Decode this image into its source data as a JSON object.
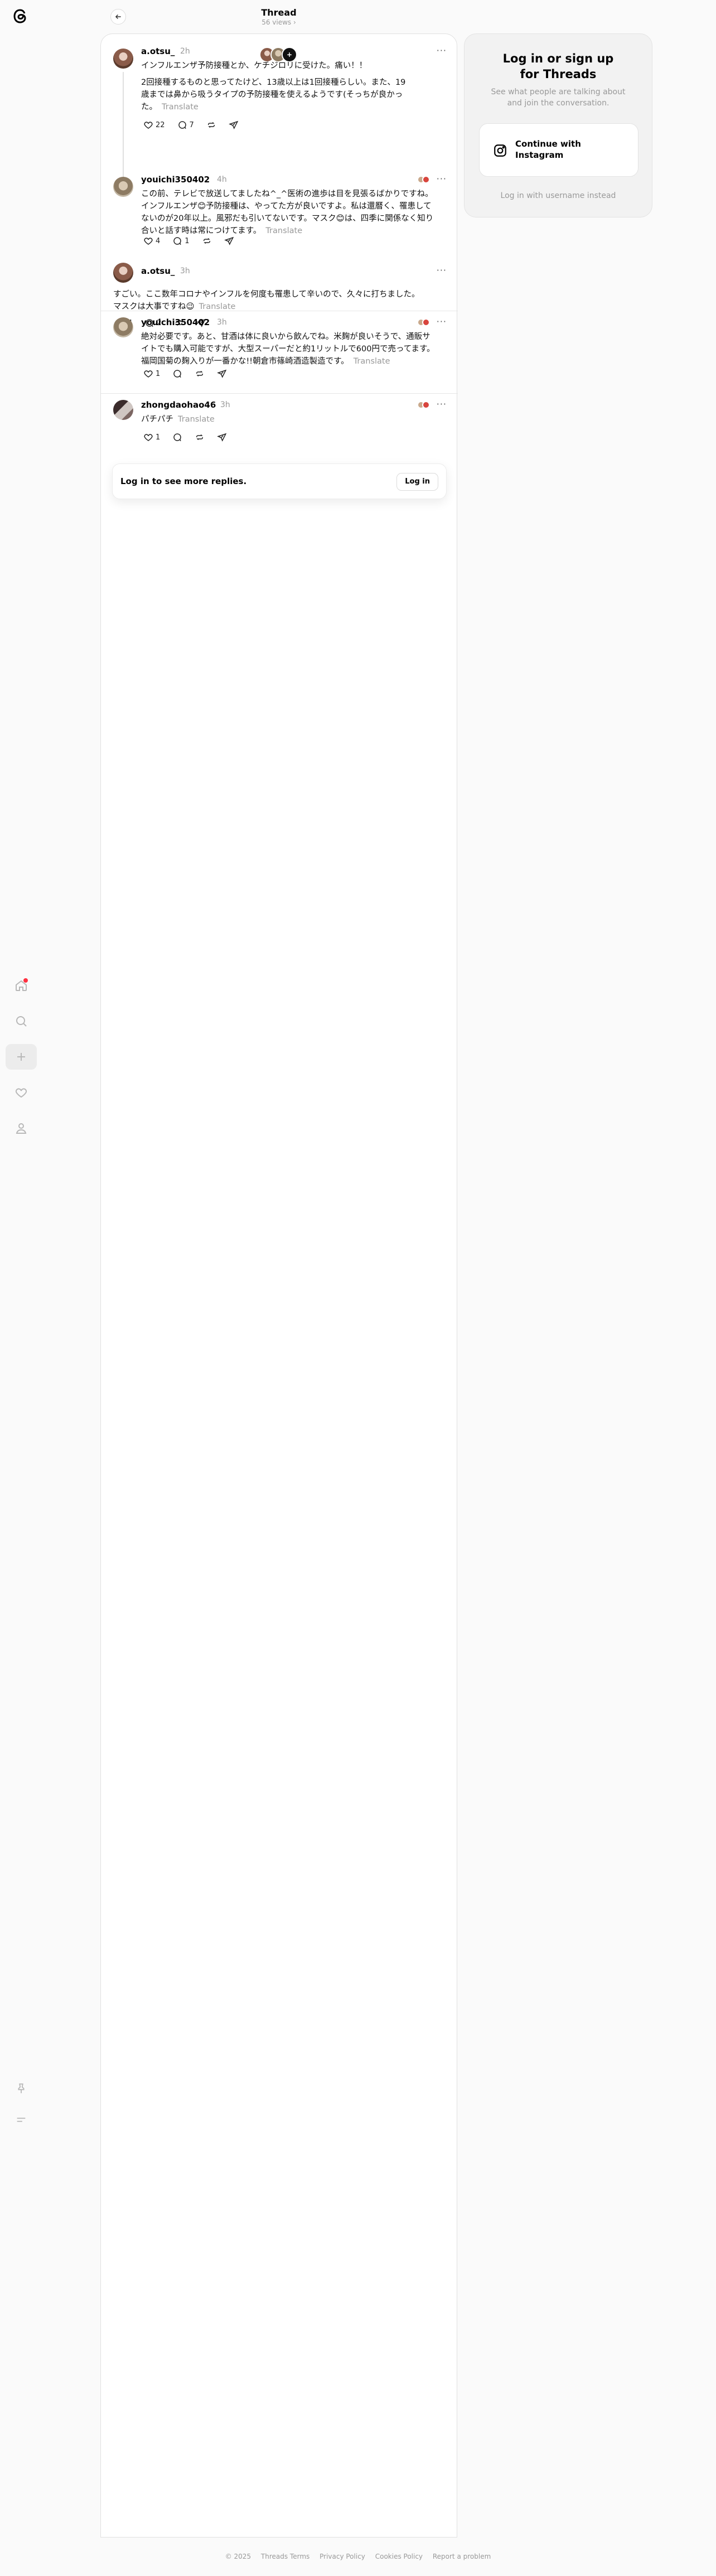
{
  "header": {
    "title": "Thread",
    "views": "56 views",
    "back_icon": "arrow-left-icon"
  },
  "sidebar": {
    "items": [
      {
        "name": "home",
        "icon": "home-icon"
      },
      {
        "name": "search",
        "icon": "search-icon"
      },
      {
        "name": "create",
        "icon": "plus-icon"
      },
      {
        "name": "activity",
        "icon": "heart-icon"
      },
      {
        "name": "profile",
        "icon": "user-icon"
      }
    ],
    "bottom": [
      {
        "name": "pin",
        "icon": "pin-icon"
      },
      {
        "name": "menu",
        "icon": "menu-icon"
      }
    ]
  },
  "reply_faces": {
    "count": "+"
  },
  "posts": [
    {
      "user": "a.otsu_",
      "time": "2h",
      "text_lines": [
        "インフルエンザ予防接種とか、ケチジロリに受けた。痛い！！",
        "",
        "2回接種するものと思ってたけど、13歳以上は1回接種らしい。また、19",
        "歳までは鼻から吸うタイプの予防接種を使えるようです(そっちが良かっ",
        "た。"
      ],
      "translate": "Translate",
      "likes": "22",
      "comments": "7"
    },
    {
      "user": "youichi350402",
      "time": "4h",
      "text_lines": [
        "この前、テレビで放送してましたね^_^医術の進歩は目を見張るばかりですね。",
        "インフルエンザ😊予防接種は、やってた方が良いですよ。私は還曆く、罹患して",
        "ないのが20年以上。風邪だも引いてないです。マスク😊は、四季に関係なく知り",
        "合いと話す時は常につけてます。"
      ],
      "translate": "Translate",
      "likes": "4",
      "comments": "1"
    },
    {
      "user": "a.otsu_",
      "time": "3h",
      "text_lines": [
        "すごい。ここ数年コロナやインフルを何度も罹患して辛いので、久々に打ちました。",
        "マスクは大事ですね😉"
      ],
      "translate": "Translate",
      "likes": "4",
      "comments": "2"
    },
    {
      "user": "youichi350402",
      "time": "3h",
      "text_lines": [
        "絶対必要です。あと、甘酒は体に良いから飲んでね。米麹が良いそうで、通販サ",
        "イトでも購入可能ですが、大型スーパーだと約1リットルで600円で売ってます。",
        "福岡国菊の麹入りが一番かな!!朝倉市篠崎酒造製造です。"
      ],
      "translate": "Translate",
      "likes": "1",
      "comments": ""
    },
    {
      "user": "zhongdaohao46",
      "time": "3h",
      "text_lines": [
        "パチパチ"
      ],
      "translate": "Translate",
      "likes": "1",
      "comments": ""
    }
  ],
  "login_banner": {
    "text": "Log in to see more replies.",
    "button": "Log in"
  },
  "auth_card": {
    "title": "Log in or sign up for Threads",
    "subtitle": "See what people are talking about and join the conversation.",
    "instagram_button": "Continue with Instagram",
    "username_link": "Log in with username instead"
  },
  "footer": {
    "items": [
      "© 2025",
      "Threads Terms",
      "Privacy Policy",
      "Cookies Policy",
      "Report a problem"
    ]
  },
  "colors": {
    "background": "#fafafa",
    "notification_dot": "#ff3040",
    "muted_text": "#999999"
  }
}
